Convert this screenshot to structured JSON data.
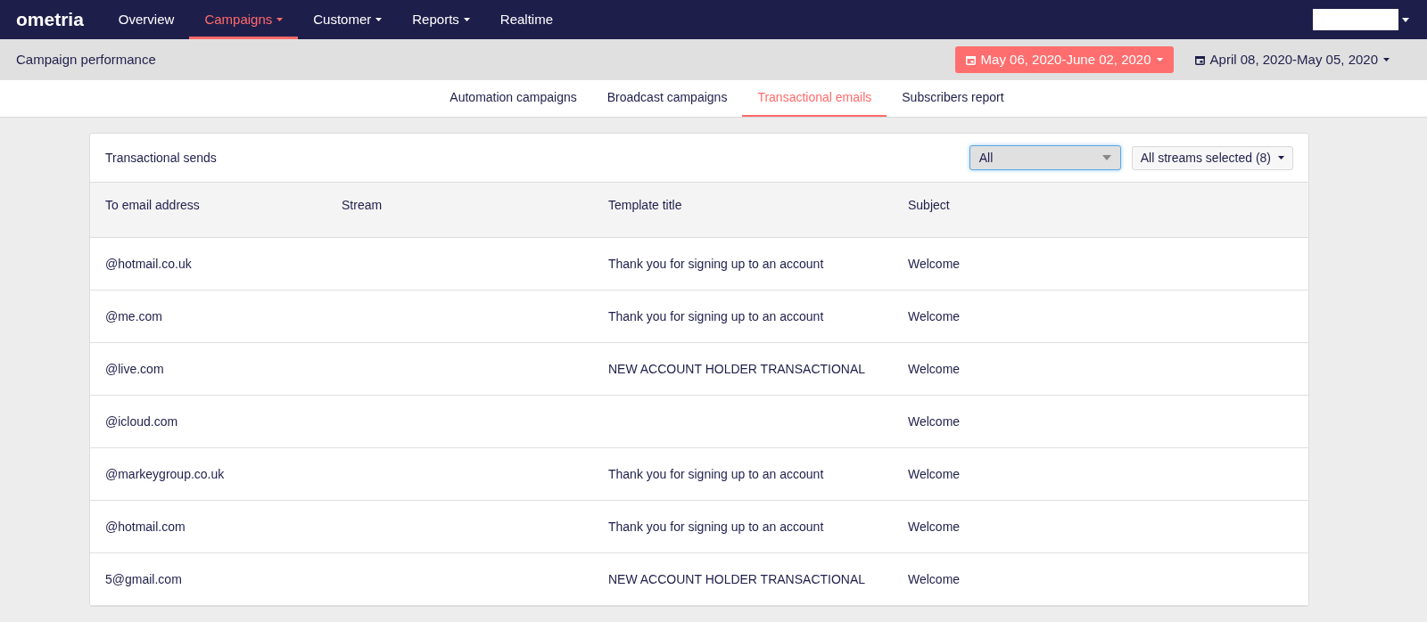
{
  "nav": {
    "logo": "ometria",
    "items": [
      {
        "label": "Overview",
        "selected": false,
        "dropdown": false
      },
      {
        "label": "Campaigns",
        "selected": true,
        "dropdown": true
      },
      {
        "label": "Customer",
        "selected": false,
        "dropdown": true
      },
      {
        "label": "Reports",
        "selected": false,
        "dropdown": true
      },
      {
        "label": "Realtime",
        "selected": false,
        "dropdown": false
      }
    ]
  },
  "subheader": {
    "title": "Campaign performance",
    "date_ranges": [
      {
        "label": "May 06, 2020-June 02, 2020",
        "selected": true
      },
      {
        "label": "April 08, 2020-May 05, 2020",
        "selected": false
      }
    ]
  },
  "tabs": [
    {
      "label": "Automation campaigns",
      "selected": false
    },
    {
      "label": "Broadcast campaigns",
      "selected": false
    },
    {
      "label": "Transactional emails",
      "selected": true
    },
    {
      "label": "Subscribers report",
      "selected": false
    }
  ],
  "card": {
    "title": "Transactional sends",
    "filter": {
      "value": "All"
    },
    "streams_button": "All streams selected (8)",
    "table": {
      "columns": [
        "To email address",
        "Stream",
        "Template title",
        "Subject"
      ],
      "rows": [
        [
          "@hotmail.co.uk",
          "",
          "Thank you for signing up to an account",
          "Welcome"
        ],
        [
          "@me.com",
          "",
          "Thank you for signing up to an account",
          "Welcome"
        ],
        [
          "@live.com",
          "",
          "NEW ACCOUNT HOLDER TRANSACTIONAL",
          "Welcome"
        ],
        [
          "@icloud.com",
          "",
          "",
          "Welcome"
        ],
        [
          "@markeygroup.co.uk",
          "",
          "Thank you for signing up to an account",
          "Welcome"
        ],
        [
          "@hotmail.com",
          "",
          "Thank you for signing up to an account",
          "Welcome"
        ],
        [
          "5@gmail.com",
          "",
          "NEW ACCOUNT HOLDER TRANSACTIONAL",
          "Welcome"
        ]
      ]
    }
  }
}
